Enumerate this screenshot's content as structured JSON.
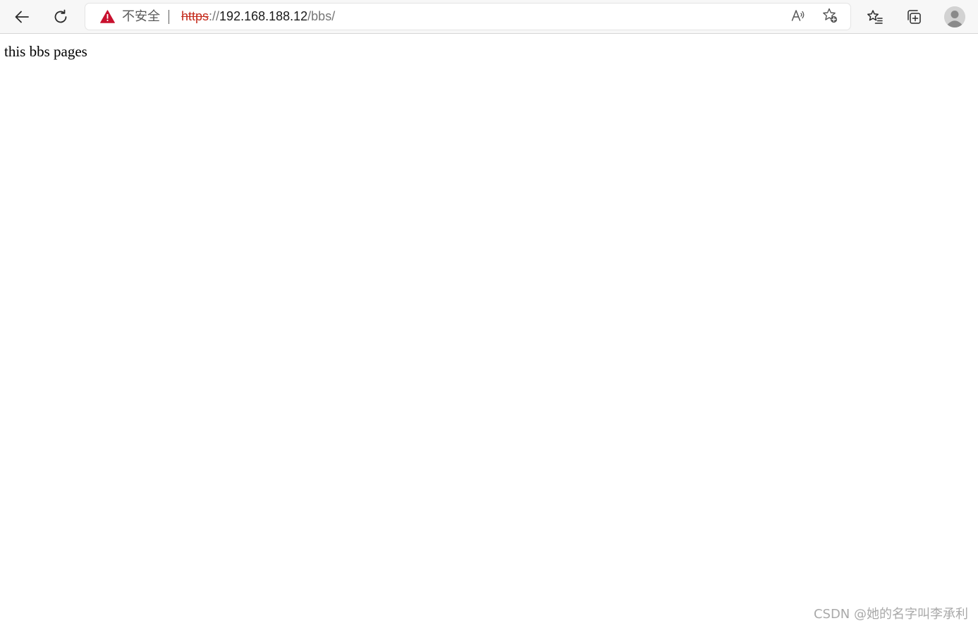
{
  "toolbar": {
    "back_icon": "arrow-left-icon",
    "refresh_icon": "refresh-icon",
    "favorites_icon": "favorites-list-icon",
    "collections_icon": "collections-icon",
    "profile_icon": "profile-avatar-icon"
  },
  "address_bar": {
    "warning_icon": "warning-triangle-icon",
    "security_label": "不安全",
    "separator": "|",
    "url_scheme": "https",
    "url_slashes": "://",
    "url_host": "192.168.188.12",
    "url_path": "/bbs/",
    "read_aloud_icon": "read-aloud-icon",
    "add_favorite_icon": "add-favorite-icon"
  },
  "page": {
    "body_text": "this bbs pages"
  },
  "watermark": {
    "text": "CSDN @她的名字叫李承利"
  },
  "colors": {
    "insecure_red": "#c42b1c",
    "toolbar_bg": "#f7f7f7",
    "text_gray": "#5a5a5a"
  }
}
